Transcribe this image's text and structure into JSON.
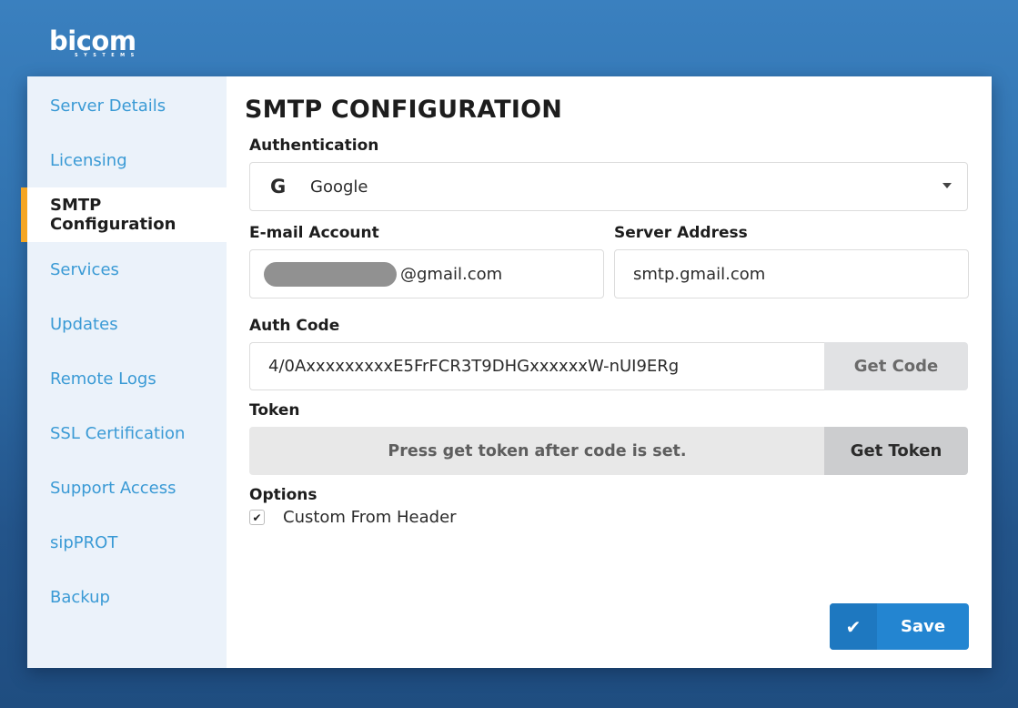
{
  "brand": {
    "name": "bicom",
    "tagline": "SYSTEMS"
  },
  "sidebar": {
    "items": [
      {
        "label": "Server Details",
        "active": false
      },
      {
        "label": "Licensing",
        "active": false
      },
      {
        "label": "SMTP Configuration",
        "active": true
      },
      {
        "label": "Services",
        "active": false
      },
      {
        "label": "Updates",
        "active": false
      },
      {
        "label": "Remote Logs",
        "active": false
      },
      {
        "label": "SSL Certification",
        "active": false
      },
      {
        "label": "Support Access",
        "active": false
      },
      {
        "label": "sipPROT",
        "active": false
      },
      {
        "label": "Backup",
        "active": false
      }
    ]
  },
  "main": {
    "title": "SMTP CONFIGURATION",
    "authentication": {
      "label": "Authentication",
      "selected": "Google",
      "icon": "G"
    },
    "email": {
      "label": "E-mail Account",
      "value_suffix": "@gmail.com"
    },
    "server": {
      "label": "Server Address",
      "value": "smtp.gmail.com"
    },
    "auth_code": {
      "label": "Auth Code",
      "value": "4/0AxxxxxxxxxE5FrFCR3T9DHGxxxxxxW-nUI9ERg",
      "button": "Get Code"
    },
    "token": {
      "label": "Token",
      "placeholder": "Press get token after code is set.",
      "button": "Get Token"
    },
    "options": {
      "label": "Options",
      "custom_from_header": {
        "label": "Custom From Header",
        "checked": true,
        "check_glyph": "✔"
      }
    },
    "save": {
      "label": "Save",
      "icon_glyph": "✔"
    }
  },
  "colors": {
    "accent": "#2385d1",
    "active_marker": "#f5a623",
    "link": "#3a9ad5",
    "sidebar_bg": "#ebf2fa"
  }
}
